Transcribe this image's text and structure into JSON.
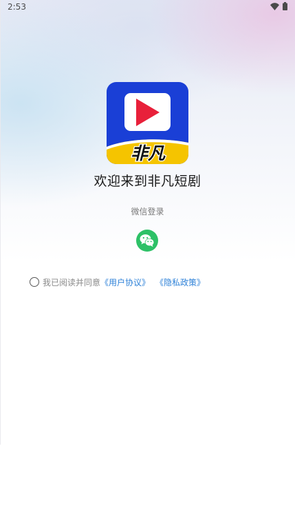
{
  "status_bar": {
    "time": "2:53",
    "wifi_icon": "wifi-icon",
    "battery_icon": "battery-icon"
  },
  "logo": {
    "icon": "play-icon",
    "badge_text": "非凡",
    "colors": {
      "background": "#1a3fd6",
      "banner": "#f5c400",
      "play": "#e8203a"
    }
  },
  "welcome": {
    "title": "欢迎来到非凡短剧"
  },
  "login": {
    "label": "微信登录",
    "wechat_icon": "wechat-icon",
    "wechat_color": "#2dc167"
  },
  "agreement": {
    "prefix": "我已阅读并同意",
    "user_agreement": "《用户协议》",
    "privacy_policy": "《隐私政策》",
    "link_color": "#2f82d8"
  }
}
